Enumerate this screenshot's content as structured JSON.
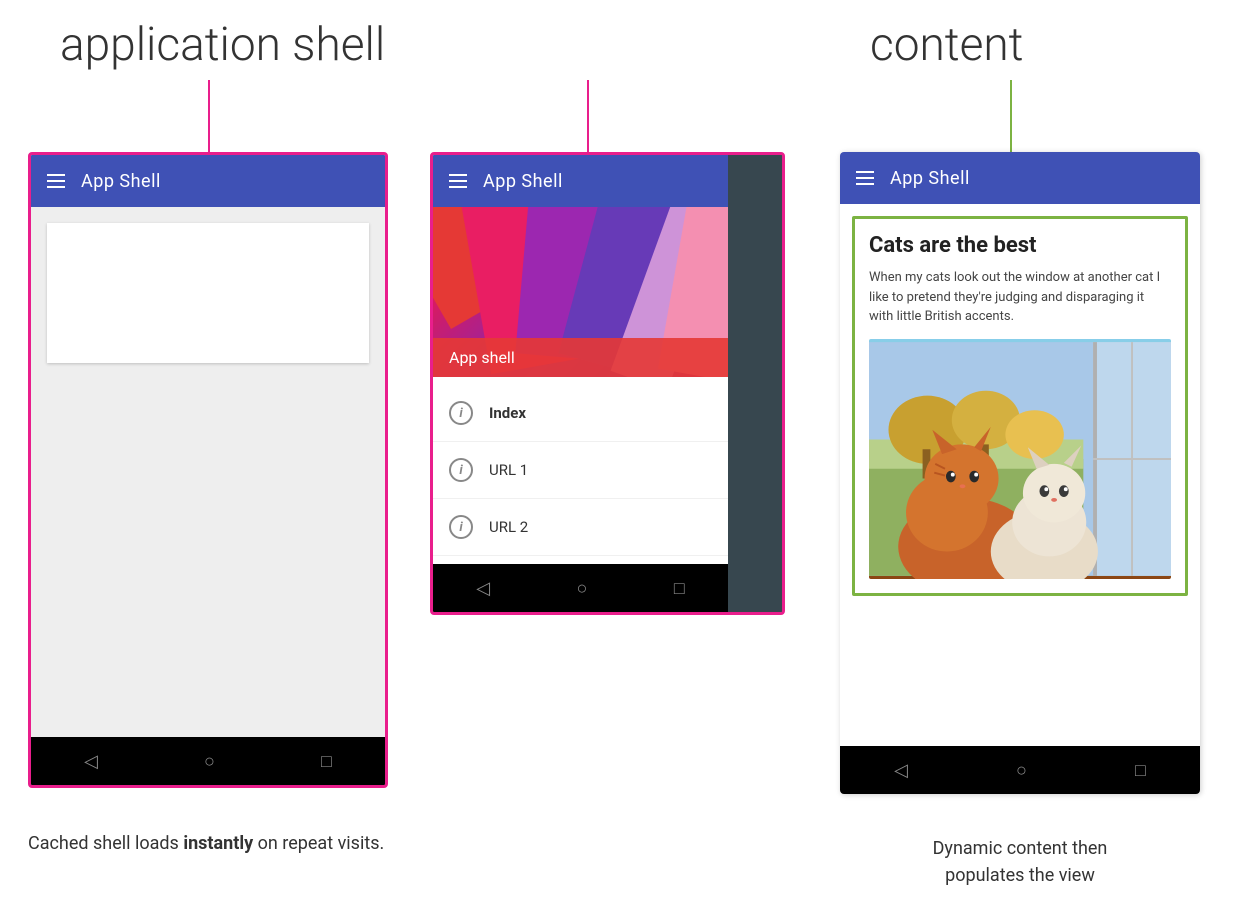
{
  "labels": {
    "app_shell_heading": "application shell",
    "content_heading": "content",
    "app_shell_bar_title": "App Shell",
    "app_shell_bar_title2": "App Shell",
    "app_shell_overlay": "App shell",
    "nav_index": "Index",
    "nav_url1": "URL 1",
    "nav_url2": "URL 2",
    "content_title": "Cats are the best",
    "content_desc": "When my cats look out the window at another cat I like to pretend they're judging and disparaging it with little British accents.",
    "caption_left_1": "Cached shell loads ",
    "caption_left_bold": "instantly",
    "caption_left_2": " on repeat visits.",
    "caption_right_1": "Dynamic content then",
    "caption_right_2": "populates the view"
  },
  "colors": {
    "pink_border": "#e91e8c",
    "green_border": "#7cb342",
    "app_bar_blue": "#3f51b5",
    "dark_bg": "#37474f",
    "nav_bg": "#000000"
  }
}
